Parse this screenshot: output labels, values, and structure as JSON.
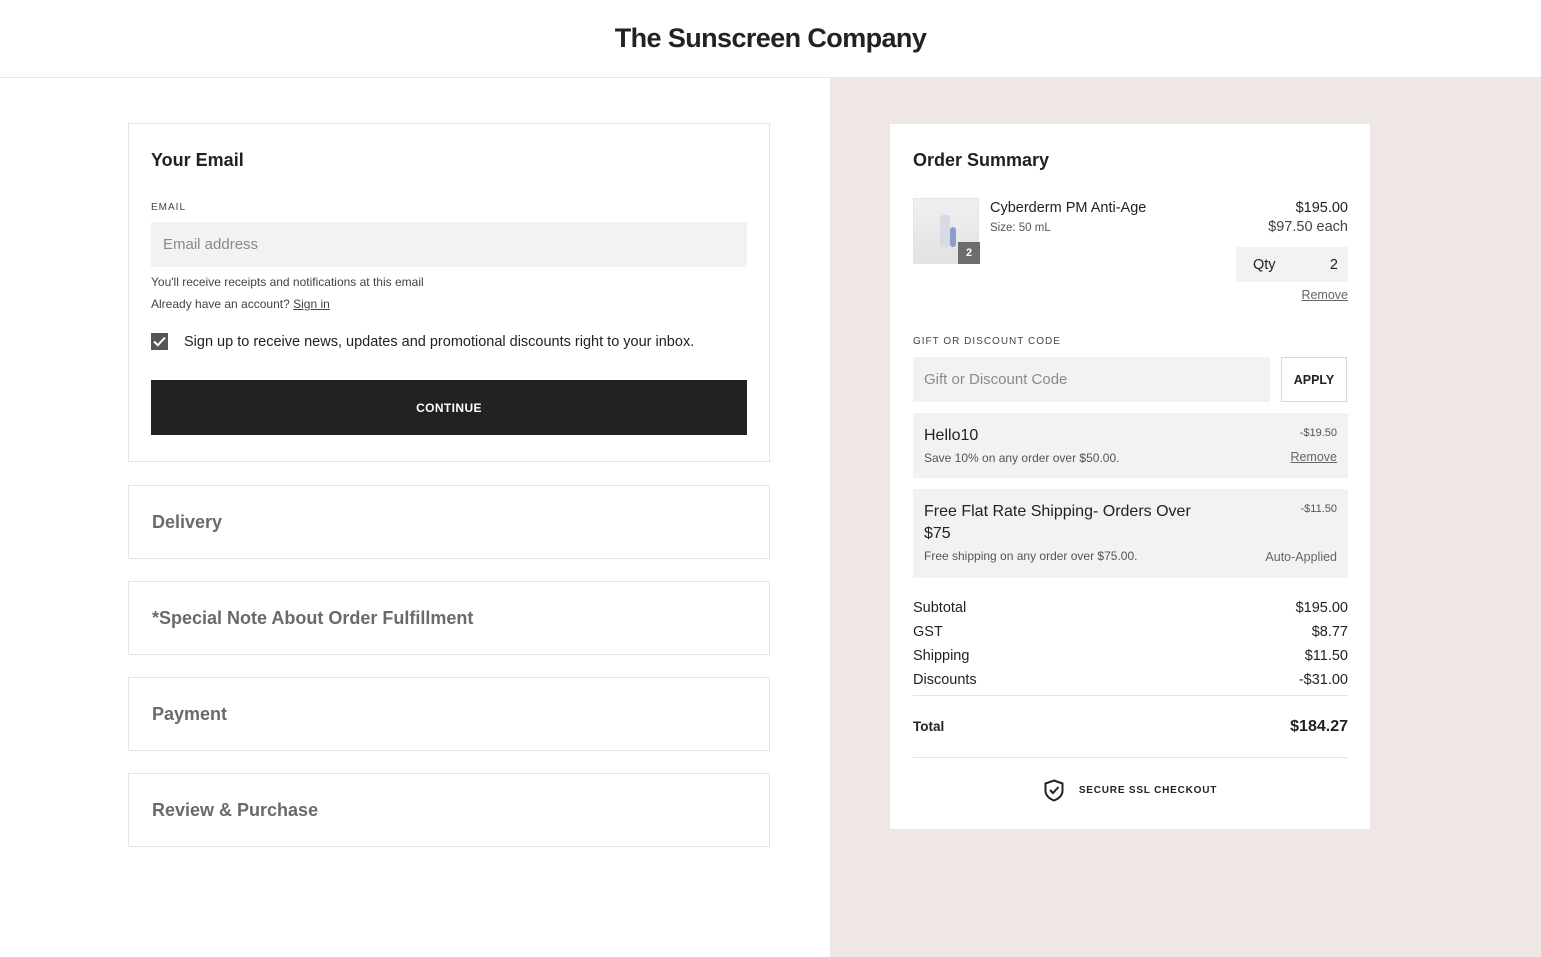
{
  "header": {
    "brand": "The Sunscreen Company"
  },
  "email_section": {
    "title": "Your Email",
    "field_label": "EMAIL",
    "placeholder": "Email address",
    "hint": "You'll receive receipts and notifications at this email",
    "account_text": "Already have an account?",
    "sign_in": "Sign in",
    "newsletter_checked": true,
    "newsletter_label": "Sign up to receive news, updates and promotional discounts right to your inbox.",
    "continue_label": "CONTINUE"
  },
  "steps": [
    {
      "label": "Delivery"
    },
    {
      "label": "*Special Note About Order Fulfillment"
    },
    {
      "label": "Payment"
    },
    {
      "label": "Review & Purchase"
    }
  ],
  "summary": {
    "title": "Order Summary",
    "item": {
      "name": "Cyberderm PM Anti-Age",
      "size": "Size: 50 mL",
      "price": "$195.00",
      "each": "$97.50 each",
      "qty_label": "Qty",
      "qty": "2",
      "badge": "2",
      "remove": "Remove"
    },
    "discount_label": "GIFT OR DISCOUNT CODE",
    "discount_placeholder": "Gift or Discount Code",
    "apply_label": "APPLY",
    "promos": [
      {
        "title": "Hello10",
        "desc": "Save 10% on any order over $50.00.",
        "amount": "-$19.50",
        "action": "Remove"
      },
      {
        "title": "Free Flat Rate Shipping- Orders Over $75",
        "desc": "Free shipping on any order over $75.00.",
        "amount": "-$11.50",
        "action": "Auto-Applied"
      }
    ],
    "rows": [
      {
        "label": "Subtotal",
        "value": "$195.00"
      },
      {
        "label": "GST",
        "value": "$8.77"
      },
      {
        "label": "Shipping",
        "value": "$11.50"
      },
      {
        "label": "Discounts",
        "value": "-$31.00"
      }
    ],
    "total_label": "Total",
    "total_value": "$184.27",
    "secure_label": "SECURE SSL CHECKOUT"
  },
  "colors": {
    "right_panel_bg": "#efe7e5",
    "button_dark": "#222222"
  }
}
